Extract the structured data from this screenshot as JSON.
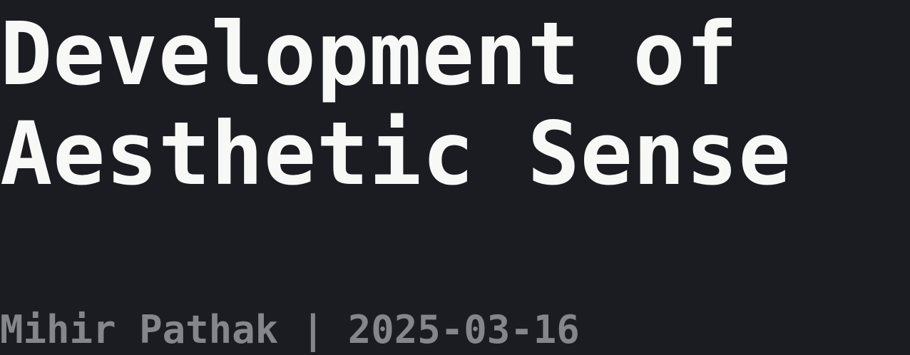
{
  "post": {
    "title_line_1": "Development of",
    "title_line_2": "Aesthetic Sense",
    "author": "Mihir Pathak",
    "separator": " | ",
    "date": "2025-03-16"
  },
  "colors": {
    "background": "#1b1c21",
    "title": "#f8f8f6",
    "meta": "#85868c"
  }
}
